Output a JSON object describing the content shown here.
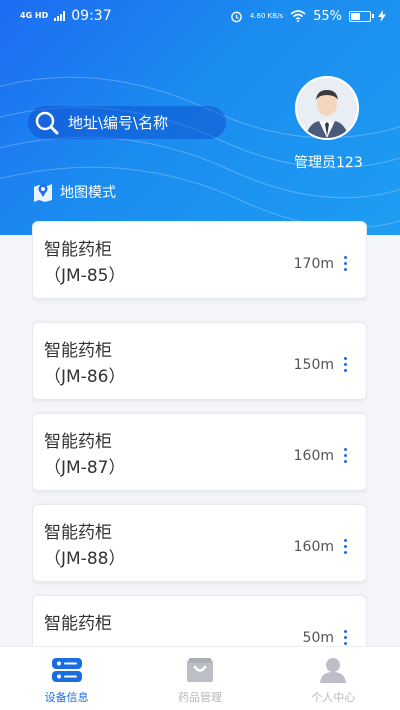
{
  "status_bar": {
    "network": "4G HD",
    "time": "09:37",
    "speed": "4.60 KB/s",
    "battery": "55%",
    "battery_level": 0.55
  },
  "header": {
    "search_placeholder": "地址\\编号\\名称",
    "map_mode": "地图模式",
    "admin_name": "管理员123"
  },
  "devices": [
    {
      "name": "智能药柜",
      "code": "（JM-85）",
      "distance": "170m"
    },
    {
      "name": "智能药柜",
      "code": "（JM-86）",
      "distance": "150m"
    },
    {
      "name": "智能药柜",
      "code": "（JM-87）",
      "distance": "160m"
    },
    {
      "name": "智能药柜",
      "code": "（JM-88）",
      "distance": "160m"
    },
    {
      "name": "智能药柜",
      "code": "",
      "distance": "50m"
    }
  ],
  "tabs": [
    {
      "label": "设备信息",
      "icon": "device-info-icon",
      "active": true
    },
    {
      "label": "药品管理",
      "icon": "medicine-bag-icon",
      "active": false
    },
    {
      "label": "个人中心",
      "icon": "person-icon",
      "active": false
    }
  ],
  "colors": {
    "primary": "#1a6fe0",
    "header_start": "#1d6cf2",
    "header_end": "#1e9df2",
    "inactive": "#b6b9bf"
  }
}
